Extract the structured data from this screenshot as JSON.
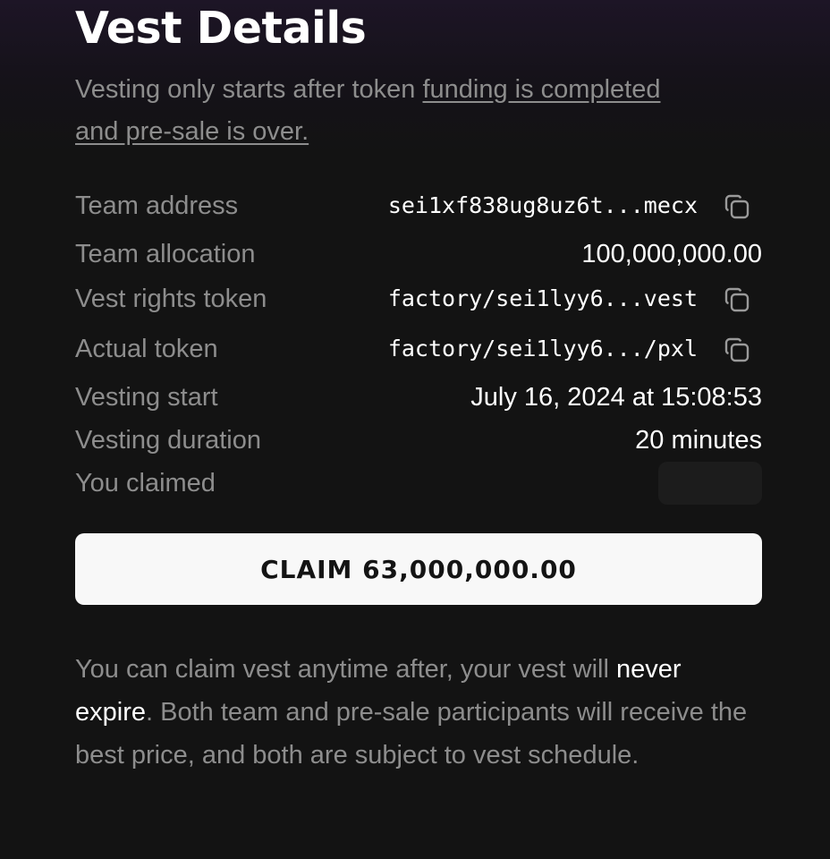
{
  "header": {
    "title": "Vest Details",
    "subtitle_text": "Vesting only starts after token ",
    "subtitle_link": "funding is completed and pre-sale is over."
  },
  "details": [
    {
      "label": "Team address",
      "value": "sei1xf838ug8uz6t...mecx",
      "copy_icon": "copy-icon"
    },
    {
      "label": "Team allocation",
      "value": "100,000,000.00"
    },
    {
      "label": "Vest rights token",
      "value": "factory/sei1lyy6...vest",
      "copy_icon": "copy-icon"
    },
    {
      "label": "Actual token",
      "value": "factory/sei1lyy6.../pxl",
      "copy_icon": "copy-icon"
    },
    {
      "label": "Vesting start",
      "value": "July 16, 2024 at 15:08:53"
    },
    {
      "label": "Vesting duration",
      "value": "20 minutes"
    },
    {
      "label": "You claimed",
      "value": null
    }
  ],
  "claim_button": {
    "label": "CLAIM 63,000,000.00"
  },
  "note": {
    "part1": "You can claim vest anytime after, your vest will ",
    "emphasis": "never expire",
    "part2": ". Both team and pre-sale participants will receive the best price, and both are subject to vest schedule."
  },
  "colors": {
    "background": "#131313",
    "text_muted": "#8d8d8d",
    "text_primary": "#ffffff",
    "button_bg": "#f8f8f8",
    "button_text": "#141414"
  }
}
